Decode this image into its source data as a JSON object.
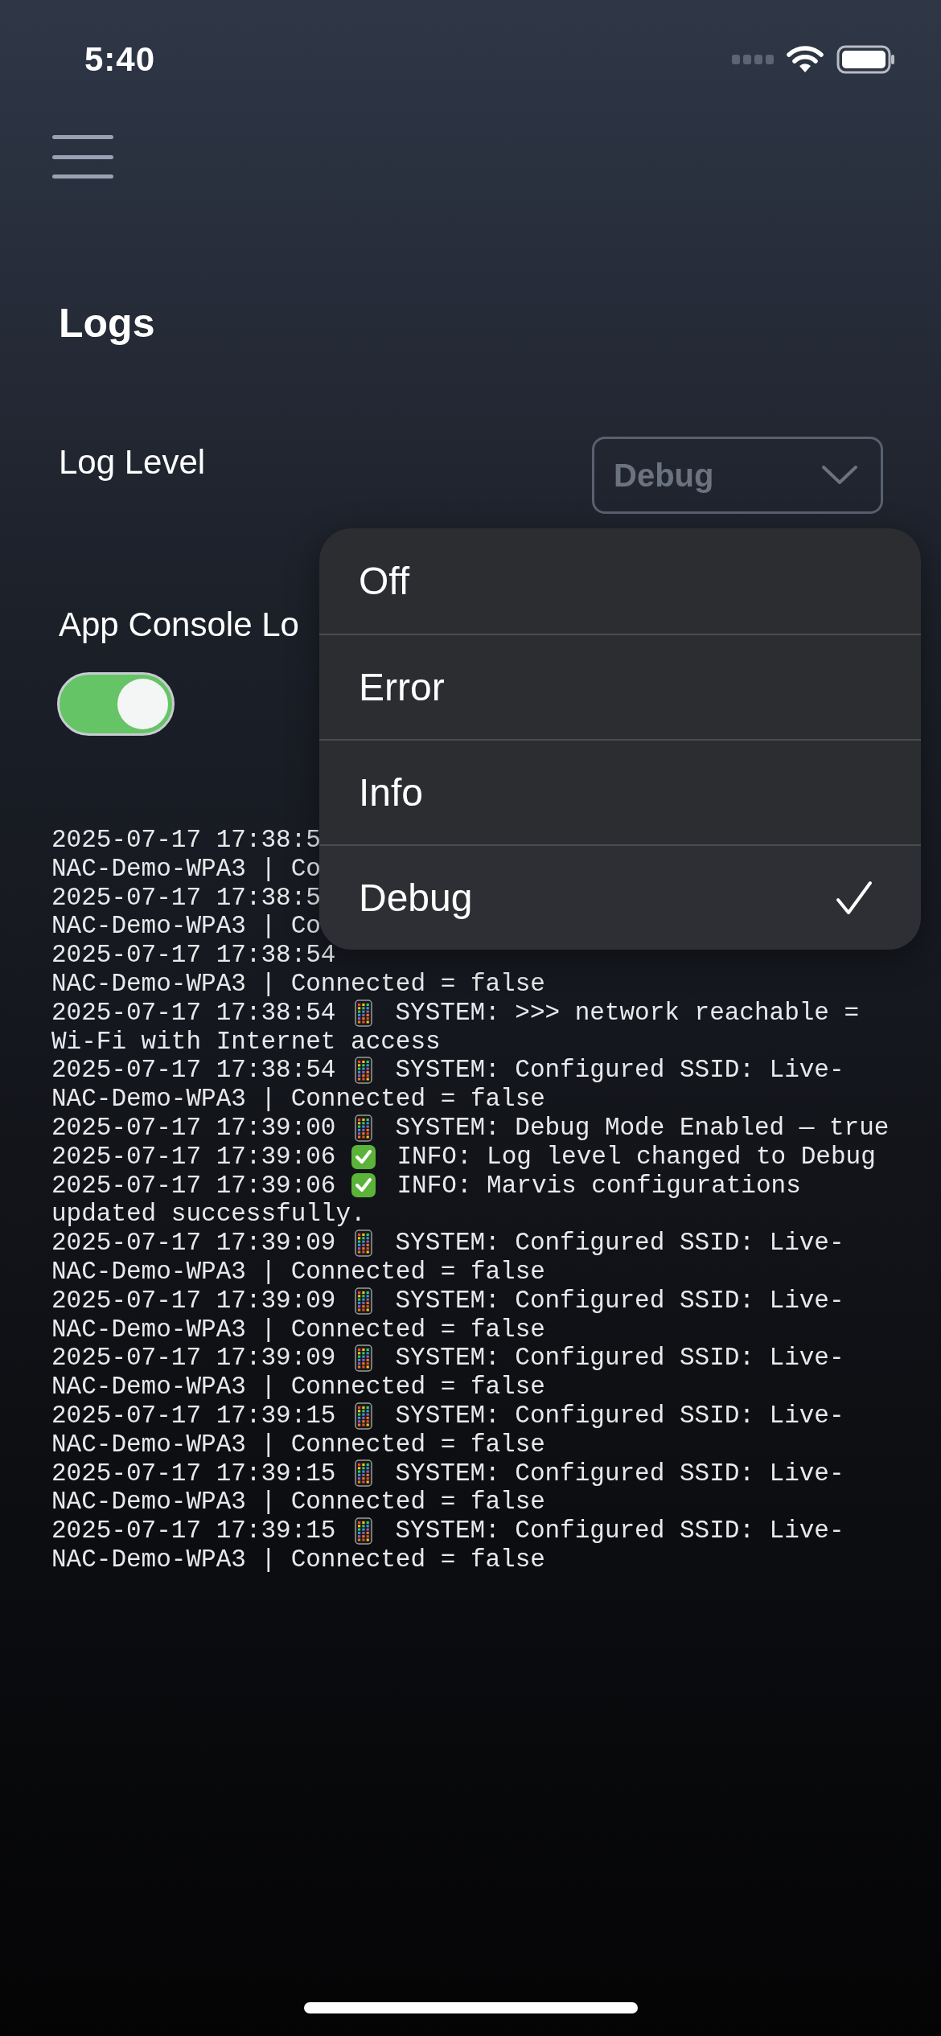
{
  "status_bar": {
    "time": "5:40"
  },
  "title": "Logs",
  "log_level": {
    "label": "Log Level",
    "value": "Debug"
  },
  "console_logging": {
    "label": "App Console Lo",
    "on": true
  },
  "log_entries": [
    {
      "kind": "covered",
      "lines": [
        "2025-07-17 17:38:5",
        "NAC-Demo-WPA3 | Co"
      ]
    },
    {
      "kind": "covered",
      "lines": [
        "2025-07-17 17:38:5",
        "NAC-Demo-WPA3 | Co"
      ]
    },
    {
      "kind": "covered",
      "lines": [
        "2025-07-17 17:38:54",
        "NAC-Demo-WPA3 | Connected = false"
      ]
    },
    {
      "kind": "system",
      "time": "2025-07-17 17:38:54",
      "text": "SYSTEM: >>> network reachable =",
      "continuation": "Wi-Fi with Internet access"
    },
    {
      "kind": "system",
      "time": "2025-07-17 17:38:54",
      "text": "SYSTEM: Configured SSID: Live-",
      "continuation": "NAC-Demo-WPA3 | Connected = false"
    },
    {
      "kind": "system",
      "time": "2025-07-17 17:39:00",
      "text": "SYSTEM: Debug Mode Enabled — true"
    },
    {
      "kind": "info",
      "time": "2025-07-17 17:39:06",
      "text": "INFO: Log level changed to Debug"
    },
    {
      "kind": "info",
      "time": "2025-07-17 17:39:06",
      "text": "INFO: Marvis configurations",
      "continuation": "updated successfully."
    },
    {
      "kind": "system",
      "time": "2025-07-17 17:39:09",
      "text": "SYSTEM: Configured SSID: Live-",
      "continuation": "NAC-Demo-WPA3 | Connected = false"
    },
    {
      "kind": "system",
      "time": "2025-07-17 17:39:09",
      "text": "SYSTEM: Configured SSID: Live-",
      "continuation": "NAC-Demo-WPA3 | Connected = false"
    },
    {
      "kind": "system",
      "time": "2025-07-17 17:39:09",
      "text": "SYSTEM: Configured SSID: Live-",
      "continuation": "NAC-Demo-WPA3 | Connected = false"
    },
    {
      "kind": "system",
      "time": "2025-07-17 17:39:15",
      "text": "SYSTEM: Configured SSID: Live-",
      "continuation": "NAC-Demo-WPA3 | Connected = false"
    },
    {
      "kind": "system",
      "time": "2025-07-17 17:39:15",
      "text": "SYSTEM: Configured SSID: Live-",
      "continuation": "NAC-Demo-WPA3 | Connected = false"
    },
    {
      "kind": "system",
      "time": "2025-07-17 17:39:15",
      "text": "SYSTEM: Configured SSID: Live-",
      "continuation": "NAC-Demo-WPA3 | Connected = false"
    }
  ],
  "level_menu": [
    {
      "label": "Off",
      "selected": false
    },
    {
      "label": "Error",
      "selected": false
    },
    {
      "label": "Info",
      "selected": false
    },
    {
      "label": "Debug",
      "selected": true
    }
  ]
}
